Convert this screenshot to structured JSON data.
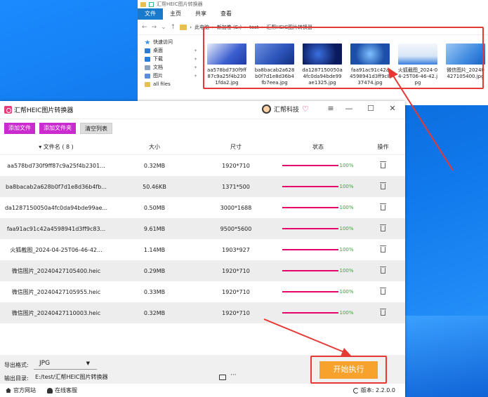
{
  "colors": {
    "accent": "#c92bcf",
    "progress": "#e5006b",
    "start": "#f7a22c",
    "annotation": "#e53935"
  },
  "explorer": {
    "title": "汇帮HEIC图片转换器",
    "ribbon": [
      "文件",
      "主页",
      "共享",
      "查看"
    ],
    "address": [
      "此电脑",
      "新加卷 (E:)",
      "test",
      "汇帮HEIC图片转换器"
    ],
    "nav": [
      {
        "label": "快速访问",
        "icon": "star-icon",
        "color": "#3a8ee6"
      },
      {
        "label": "桌面",
        "icon": "desktop-icon",
        "color": "#2b7cd3"
      },
      {
        "label": "下载",
        "icon": "download-icon",
        "color": "#2b7cd3"
      },
      {
        "label": "文档",
        "icon": "document-icon",
        "color": "#8aa2c0"
      },
      {
        "label": "图片",
        "icon": "picture-icon",
        "color": "#5a8fd8"
      },
      {
        "label": "all files",
        "icon": "folder-icon",
        "color": "#e8c050"
      }
    ],
    "files": [
      {
        "name": "aa578bd730f9ff87c9a25f4b2301fda2.jpg",
        "color": "#3c5fcf"
      },
      {
        "name": "ba8bacab2a628b0f7d1e8d36b4fb7eea.jpg",
        "color": "#2a52b8"
      },
      {
        "name": "da1287150050a4fc0da94bde99ae1325.jpg",
        "color": "#0a1a5c"
      },
      {
        "name": "faa91ac91c42a4598941d3ff9c837474.jpg",
        "color": "#1b4fa8"
      },
      {
        "name": "火狐截图_2024-04-25T06-46-42.jpg",
        "color": "#d7e6f7"
      },
      {
        "name": "微信图片_20240427105400.jpg",
        "color": "#3f8ae0"
      }
    ]
  },
  "app": {
    "title": "汇帮HEIC图片转换器",
    "brand": "汇帮科技",
    "toolbar": {
      "add_file": "添加文件",
      "add_folder": "添加文件夹",
      "clear_list": "清空列表"
    },
    "columns": {
      "name": "▾ 文件名 ( 8 )",
      "size": "大小",
      "dimensions": "尺寸",
      "status": "状态",
      "actions": "操作"
    },
    "rows": [
      {
        "name": "aa578bd730f9ff87c9a25f4b2301...",
        "size": "0.32MB",
        "dim": "1920*710",
        "progress": 100,
        "pct": "100%"
      },
      {
        "name": "ba8bacab2a628b0f7d1e8d36b4fb...",
        "size": "50.46KB",
        "dim": "1371*500",
        "progress": 100,
        "pct": "100%"
      },
      {
        "name": "da1287150050a4fc0da94bde99ae...",
        "size": "0.50MB",
        "dim": "3000*1688",
        "progress": 100,
        "pct": "100%"
      },
      {
        "name": "faa91ac91c42a4598941d3ff9c83...",
        "size": "9.61MB",
        "dim": "9500*5600",
        "progress": 100,
        "pct": "100%"
      },
      {
        "name": "火狐截图_2024-04-25T06-46-42...",
        "size": "1.14MB",
        "dim": "1903*927",
        "progress": 100,
        "pct": "100%"
      },
      {
        "name": "微信图片_20240427105400.heic",
        "size": "0.29MB",
        "dim": "1920*710",
        "progress": 100,
        "pct": "100%"
      },
      {
        "name": "微信图片_20240427105955.heic",
        "size": "0.33MB",
        "dim": "1920*710",
        "progress": 100,
        "pct": "100%"
      },
      {
        "name": "微信图片_20240427110003.heic",
        "size": "0.32MB",
        "dim": "1920*710",
        "progress": 100,
        "pct": "100%"
      }
    ],
    "export": {
      "format_label": "导出格式:",
      "format_value": "JPG",
      "output_label": "输出目录:",
      "output_value": "E:/test/汇帮HEIC图片转换器",
      "more": "···"
    },
    "start_button": "开始执行",
    "footer": {
      "website": "官方网站",
      "support": "在线客服",
      "version": "版本: 2.2.0.0"
    }
  }
}
